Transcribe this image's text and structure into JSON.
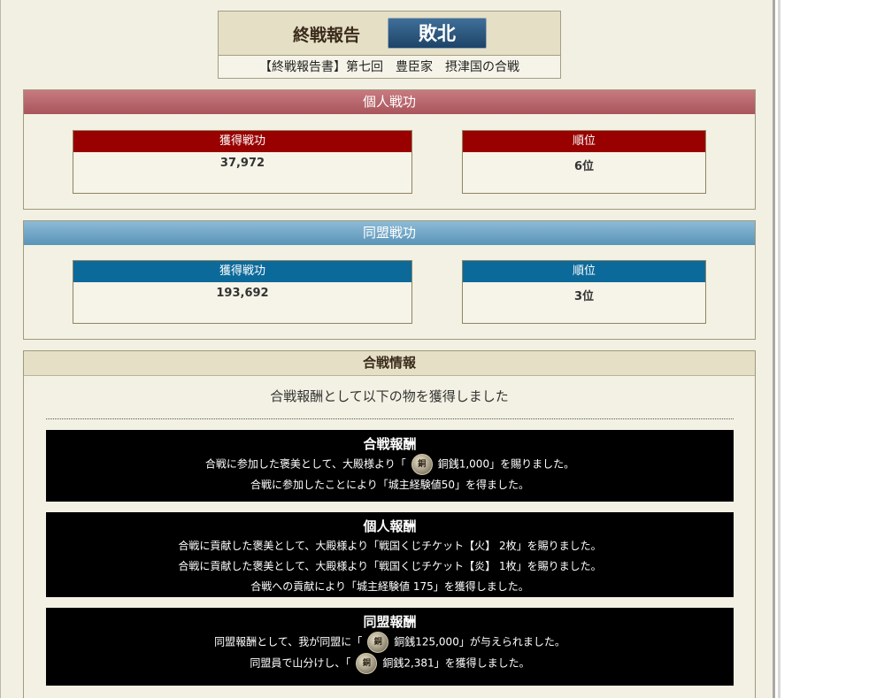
{
  "header": {
    "title": "終戦報告",
    "result": "敗北",
    "subtitle": "【終戦報告書】第七回　豊臣家　摂津国の合戦"
  },
  "personal": {
    "heading": "個人戦功",
    "earned_label": "獲得戦功",
    "earned_value": "37,972",
    "rank_label": "順位",
    "rank_value": "6位"
  },
  "alliance": {
    "heading": "同盟戦功",
    "earned_label": "獲得戦功",
    "earned_value": "193,692",
    "rank_label": "順位",
    "rank_value": "3位"
  },
  "battle": {
    "heading": "合戦情報",
    "intro": "合戦報酬として以下の物を獲得しました",
    "coin_icon": "coin-icon",
    "coin_glyph": "銅",
    "rewards": {
      "battle": {
        "title": "合戦報酬",
        "line1_pre": "合戦に参加した褒美として、大殿様より「",
        "line1_post": "銅銭1,000」を賜りました。",
        "line2": "合戦に参加したことにより「城主経験値50」を得ました。"
      },
      "personal": {
        "title": "個人報酬",
        "line1": "合戦に貢献した褒美として、大殿様より「戦国くじチケット【火】 2枚」を賜りました。",
        "line2": "合戦に貢献した褒美として、大殿様より「戦国くじチケット【炎】 1枚」を賜りました。",
        "line3": "合戦への貢献により「城主経験値 175」を獲得しました。"
      },
      "alliance": {
        "title": "同盟報酬",
        "line1_pre": "同盟報酬として、我が同盟に「",
        "line1_post": "銅銭125,000」が与えられました。",
        "line2_pre": "同盟員で山分けし、「",
        "line2_post": "銅銭2,381」を獲得しました。"
      }
    }
  }
}
